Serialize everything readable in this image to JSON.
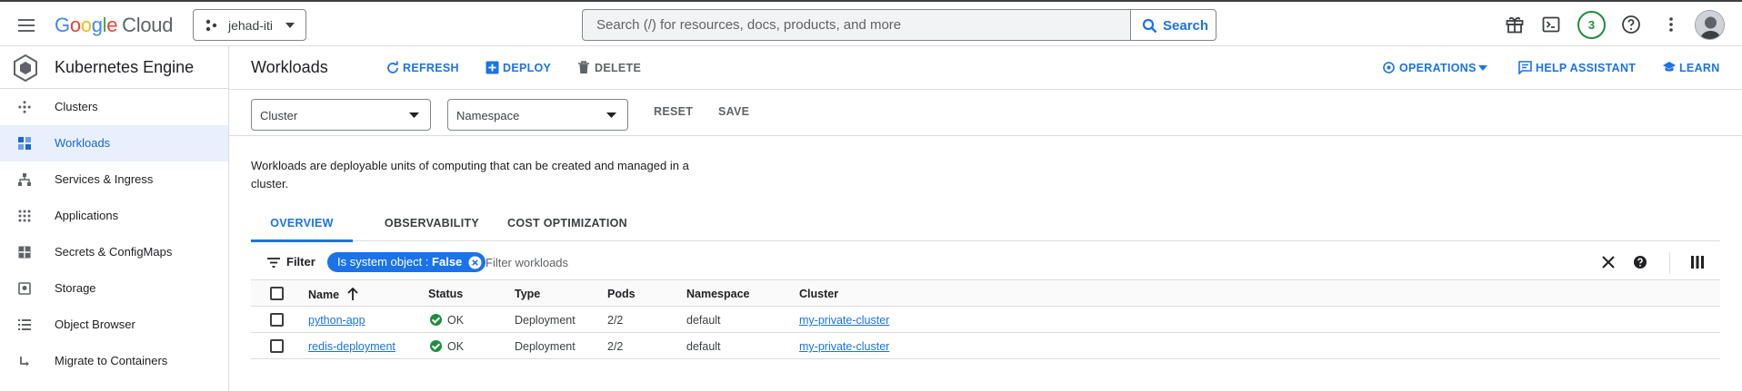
{
  "topbar": {
    "logo_google": "Google",
    "logo_cloud": "Cloud",
    "project_name": "jehad-iti",
    "search_placeholder": "Search (/) for resources, docs, products, and more",
    "search_button": "Search",
    "notification_count": "3"
  },
  "sidebar": {
    "product_title": "Kubernetes Engine",
    "items": [
      {
        "label": "Clusters",
        "icon": "clusters-icon"
      },
      {
        "label": "Workloads",
        "icon": "workloads-icon",
        "active": true
      },
      {
        "label": "Services & Ingress",
        "icon": "services-icon"
      },
      {
        "label": "Applications",
        "icon": "applications-icon"
      },
      {
        "label": "Secrets & ConfigMaps",
        "icon": "secrets-icon"
      },
      {
        "label": "Storage",
        "icon": "storage-icon"
      },
      {
        "label": "Object Browser",
        "icon": "object-browser-icon"
      },
      {
        "label": "Migrate to Containers",
        "icon": "migrate-icon"
      }
    ]
  },
  "header": {
    "title": "Workloads",
    "refresh": "REFRESH",
    "deploy": "DEPLOY",
    "delete": "DELETE",
    "operations": "OPERATIONS",
    "help_assistant": "HELP ASSISTANT",
    "learn": "LEARN"
  },
  "filters": {
    "cluster_placeholder": "Cluster",
    "namespace_placeholder": "Namespace",
    "reset": "RESET",
    "save": "SAVE"
  },
  "description": "Workloads are deployable units of computing that can be created and managed in a cluster.",
  "tabs": [
    {
      "label": "OVERVIEW",
      "active": true
    },
    {
      "label": "OBSERVABILITY"
    },
    {
      "label": "COST OPTIMIZATION"
    }
  ],
  "table": {
    "filter_label": "Filter",
    "chip_label": "Is system object : ",
    "chip_value": "False",
    "filter_placeholder": "Filter workloads",
    "columns": [
      "Name",
      "Status",
      "Type",
      "Pods",
      "Namespace",
      "Cluster"
    ],
    "rows": [
      {
        "name": "python-app",
        "status": "OK",
        "type": "Deployment",
        "pods": "2/2",
        "namespace": "default",
        "cluster": "my-private-cluster"
      },
      {
        "name": "redis-deployment",
        "status": "OK",
        "type": "Deployment",
        "pods": "2/2",
        "namespace": "default",
        "cluster": "my-private-cluster"
      }
    ]
  },
  "colors": {
    "accent": "#1a73e8",
    "active_bg": "#e8f0fe",
    "status_ok": "#1e8e3e"
  }
}
